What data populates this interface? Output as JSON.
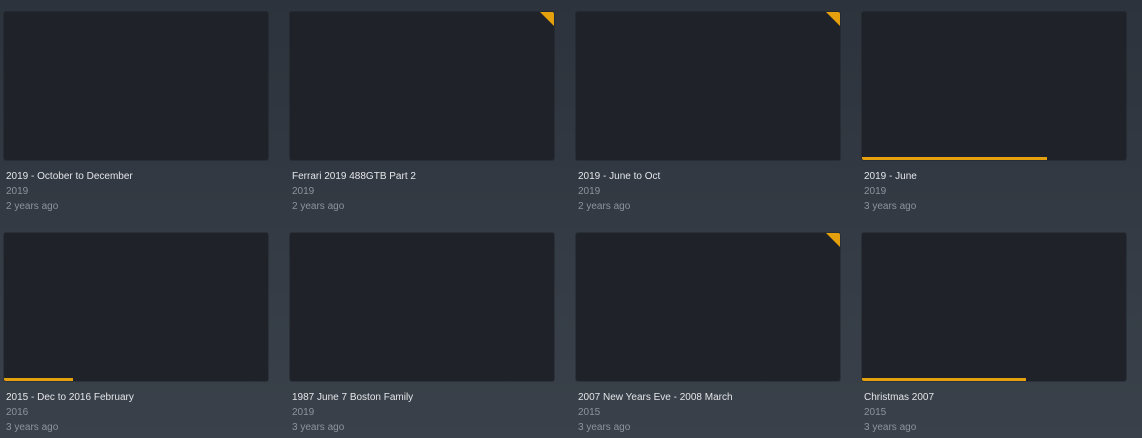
{
  "colors": {
    "accent": "#e5a00d",
    "poster_bg": "#1f2329",
    "title_text": "#e4e6e9",
    "meta_text": "#8d939b"
  },
  "cards": [
    {
      "title": "2019 - October to December",
      "year": "2019",
      "added": "2 years ago",
      "unwatched": false,
      "progress": 0
    },
    {
      "title": "Ferrari 2019 488GTB Part 2",
      "year": "2019",
      "added": "2 years ago",
      "unwatched": true,
      "progress": 0
    },
    {
      "title": "2019 - June to Oct",
      "year": "2019",
      "added": "2 years ago",
      "unwatched": true,
      "progress": 0
    },
    {
      "title": "2019 - June",
      "year": "2019",
      "added": "3 years ago",
      "unwatched": false,
      "progress": 0.7
    },
    {
      "title": "2015 - Dec to 2016 February",
      "year": "2016",
      "added": "3 years ago",
      "unwatched": false,
      "progress": 0.26
    },
    {
      "title": "1987 June 7 Boston Family",
      "year": "2019",
      "added": "3 years ago",
      "unwatched": false,
      "progress": 0
    },
    {
      "title": "2007 New Years Eve - 2008 March",
      "year": "2015",
      "added": "3 years ago",
      "unwatched": true,
      "progress": 0
    },
    {
      "title": "Christmas 2007",
      "year": "2015",
      "added": "3 years ago",
      "unwatched": false,
      "progress": 0.62
    }
  ]
}
